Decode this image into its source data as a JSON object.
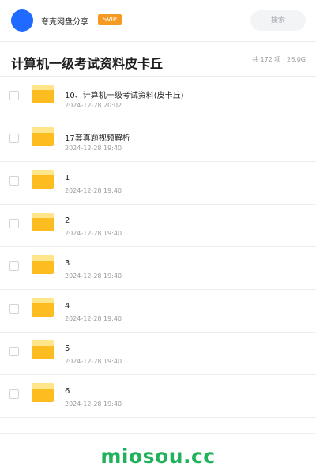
{
  "header": {
    "title": "夸克网盘分享",
    "badge": "SVIP",
    "search_label": "搜索",
    "accent_color": "#1f6bff",
    "badge_color": "#f59a23"
  },
  "folder": {
    "title": "计算机一级考试资料皮卡丘",
    "meta": "共 172 项 · 26.0G"
  },
  "files": [
    {
      "name": "10、计算机一级考试资料(皮卡丘)",
      "date": "2024-12-28 20:02",
      "icon": "folder-icon"
    },
    {
      "name": "17套真题视频解析",
      "date": "2024-12-28 19:40",
      "icon": "folder-icon"
    },
    {
      "name": "1",
      "date": "2024-12-28 19:40",
      "icon": "folder-icon"
    },
    {
      "name": "2",
      "date": "2024-12-28 19:40",
      "icon": "folder-icon"
    },
    {
      "name": "3",
      "date": "2024-12-28 19:40",
      "icon": "folder-icon"
    },
    {
      "name": "4",
      "date": "2024-12-28 19:40",
      "icon": "folder-icon"
    },
    {
      "name": "5",
      "date": "2024-12-28 19:40",
      "icon": "folder-icon"
    },
    {
      "name": "6",
      "date": "2024-12-28 19:40",
      "icon": "folder-icon"
    }
  ],
  "brand": {
    "text": "miosou.cc",
    "color": "#1fb25a"
  }
}
